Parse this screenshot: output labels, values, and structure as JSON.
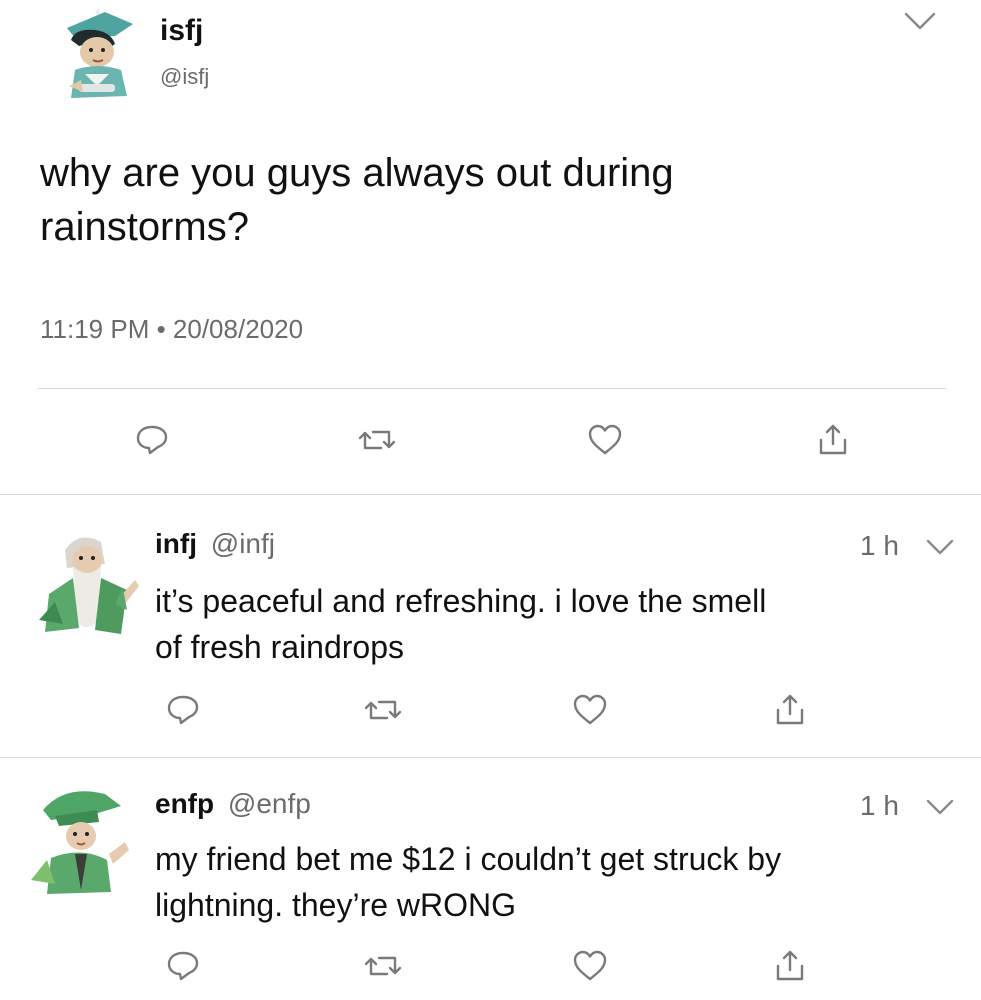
{
  "main_tweet": {
    "display_name": "isfj",
    "handle": "@isfj",
    "text_line1": "why are you guys always out during",
    "text_line2": "rainstorms?",
    "timestamp": "11:19 PM • 20/08/2020",
    "avatar_icon": "nurse-character-avatar"
  },
  "replies": [
    {
      "display_name": "infj",
      "handle": "@infj",
      "time": "1 h",
      "text_line1": "it’s peaceful and refreshing. i love the smell",
      "text_line2": "of fresh raindrops",
      "avatar_icon": "wizard-character-avatar"
    },
    {
      "display_name": "enfp",
      "handle": "@enfp",
      "time": "1 h",
      "text_line1": "my friend bet me $12 i couldn’t get struck by",
      "text_line2": "lightning. they’re wRONG",
      "avatar_icon": "green-hat-character-avatar"
    }
  ],
  "action_icons": [
    "reply-icon",
    "retweet-icon",
    "like-icon",
    "share-icon"
  ],
  "colors": {
    "text": "#111111",
    "secondary_text": "#6b6b6b",
    "icon": "#7a7a7a",
    "divider": "#d9d9d9",
    "avatar_green": "#5aa86b",
    "avatar_teal": "#5fb3a3"
  }
}
